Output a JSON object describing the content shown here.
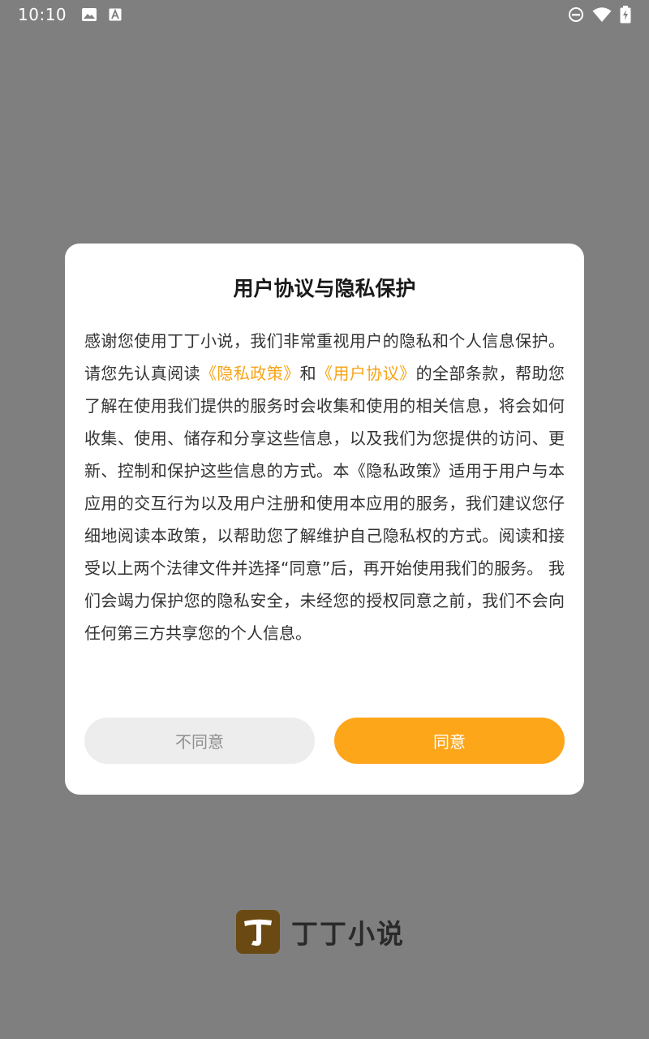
{
  "status_bar": {
    "time": "10:10",
    "left_icons": [
      "image-icon",
      "text-a-icon"
    ],
    "right_icons": [
      "do-not-disturb-icon",
      "wifi-icon",
      "battery-charging-icon"
    ]
  },
  "dialog": {
    "title": "用户协议与隐私保护",
    "body": {
      "p1": "感谢您使用丁丁小说，我们非常重视用户的隐私和个人信息保护。请您先认真阅读",
      "link_privacy": "《隐私政策》",
      "and": "和",
      "link_agreement": "《用户协议》",
      "p2": "的全部条款，帮助您了解在使用我们提供的服务时会收集和使用的相关信息，将会如何收集、使用、储存和分享这些信息，以及我们为您提供的访问、更新、控制和保护这些信息的方式。本《隐私政策》适用于用户与本应用的交互行为以及用户注册和使用本应用的服务，我们建议您仔细地阅读本政策，以帮助您了解维护自己隐私权的方式。阅读和接受以上两个法律文件并选择“同意”后，再开始使用我们的服务。 我们会竭力保护您的隐私安全，未经您的授权同意之前，我们不会向任何第三方共享您的个人信息。"
    },
    "disagree_label": "不同意",
    "agree_label": "同意"
  },
  "brand": {
    "logo_char": "丁",
    "name": "丁丁小说"
  },
  "colors": {
    "accent": "#fda61a",
    "link": "#f6a418",
    "overlay": "#7f7f7f",
    "logo_bg": "#6a4a12"
  }
}
